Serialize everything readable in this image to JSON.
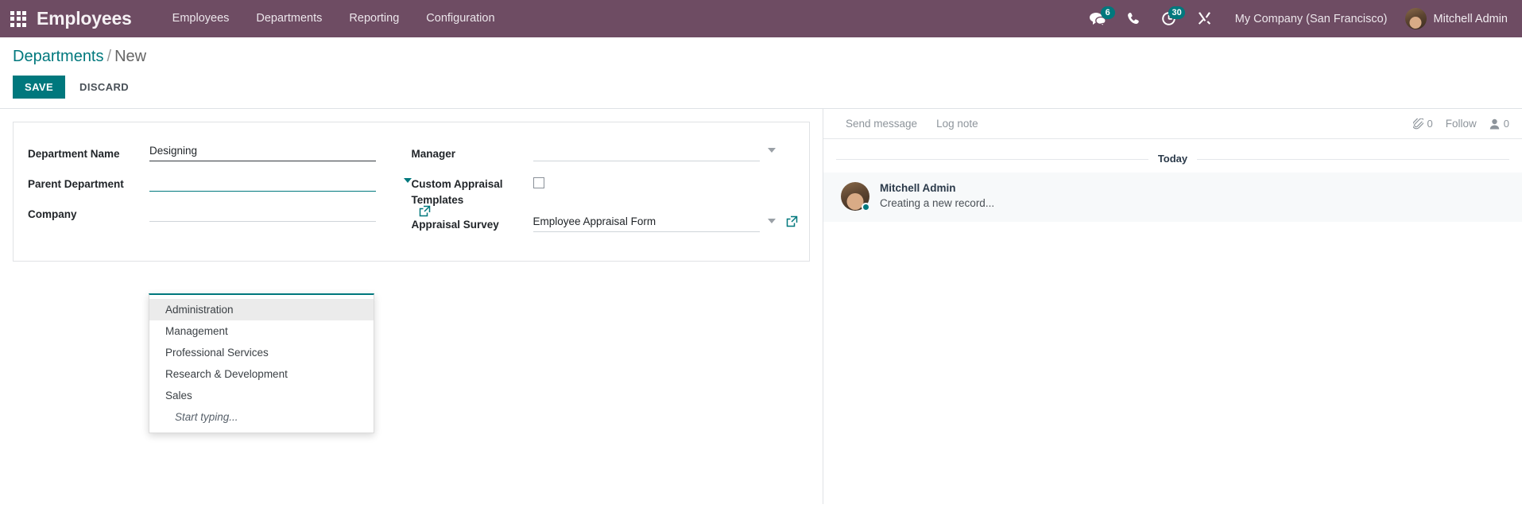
{
  "navbar": {
    "apps_icon": "apps-grid-icon",
    "brand": "Employees",
    "menu": [
      {
        "label": "Employees",
        "name": "menu-employees"
      },
      {
        "label": "Departments",
        "name": "menu-departments"
      },
      {
        "label": "Reporting",
        "name": "menu-reporting"
      },
      {
        "label": "Configuration",
        "name": "menu-configuration"
      }
    ],
    "messages_badge": "6",
    "activities_badge": "30",
    "company": "My Company (San Francisco)",
    "user": "Mitchell Admin",
    "accent_color": "#6e4c63",
    "badge_color": "#00787d"
  },
  "control_panel": {
    "breadcrumb_root": "Departments",
    "breadcrumb_sep": "/",
    "breadcrumb_current": "New",
    "save_label": "SAVE",
    "discard_label": "DISCARD"
  },
  "form": {
    "department_name": {
      "label": "Department Name",
      "value": "Designing",
      "placeholder": ""
    },
    "parent_department": {
      "label": "Parent Department",
      "value": "",
      "placeholder": ""
    },
    "company": {
      "label": "Company",
      "value": "",
      "placeholder": ""
    },
    "manager": {
      "label": "Manager",
      "value": "",
      "placeholder": ""
    },
    "custom_appraisal_templates": {
      "label": "Custom Appraisal Templates",
      "checked": false
    },
    "appraisal_survey": {
      "label": "Appraisal Survey",
      "value": "Employee Appraisal Form",
      "placeholder": ""
    }
  },
  "dropdown": {
    "open": true,
    "items": [
      {
        "label": "Administration",
        "active": true
      },
      {
        "label": "Management",
        "active": false
      },
      {
        "label": "Professional Services",
        "active": false
      },
      {
        "label": "Research & Development",
        "active": false
      },
      {
        "label": "Sales",
        "active": false
      }
    ],
    "hint": "Start typing..."
  },
  "chatter": {
    "send_message_label": "Send message",
    "log_note_label": "Log note",
    "attachment_count": "0",
    "follow_label": "Follow",
    "follower_count": "0",
    "day_separator": "Today",
    "message": {
      "author": "Mitchell Admin",
      "body": "Creating a new record..."
    }
  }
}
